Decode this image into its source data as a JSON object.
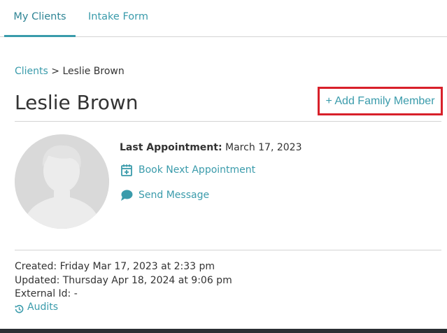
{
  "tabs": [
    {
      "label": "My Clients",
      "active": true
    },
    {
      "label": "Intake Form",
      "active": false
    }
  ],
  "breadcrumb": {
    "root": "Clients",
    "separator": ">",
    "current": "Leslie Brown"
  },
  "client": {
    "name": "Leslie Brown",
    "last_appointment_label": "Last Appointment:",
    "last_appointment_value": "March 17, 2023"
  },
  "actions": {
    "add_family_member": "+ Add Family Member",
    "book_next": "Book Next Appointment",
    "send_message": "Send Message"
  },
  "meta": {
    "created": "Created: Friday Mar 17, 2023 at 2:33 pm",
    "updated": "Updated: Thursday Apr 18, 2024 at 9:06 pm",
    "external_id": "External Id: -",
    "audits": "Audits"
  },
  "icons": {
    "book": "calendar-plus-icon",
    "message": "chat-bubble-icon",
    "audits": "history-icon",
    "avatar": "avatar-placeholder"
  },
  "colors": {
    "accent": "#3a9bab",
    "highlight_border": "#d8202a",
    "text": "#333333",
    "divider": "#d4d4d4",
    "avatar_bg": "#d9d9d9"
  }
}
